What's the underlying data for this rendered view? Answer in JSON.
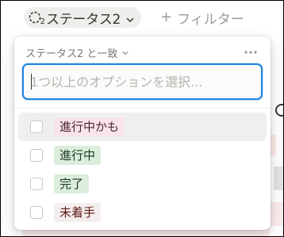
{
  "filter_bar": {
    "status_chip": {
      "label": "ステータス2",
      "badge": "2",
      "icon": "status-icon",
      "chevron_icon": "chevron-down-icon"
    },
    "add_filter": {
      "plus": "+",
      "label": "フィルター"
    }
  },
  "popup": {
    "condition": "ステータス2 と一致",
    "condition_icon": "chevron-down-icon",
    "more_icon": "more-horizontal-icon",
    "search": {
      "value": "",
      "placeholder": "1つ以上のオプションを選択..."
    },
    "options": [
      {
        "label": "進行中かも",
        "checked": false,
        "bg": "#f9e4ec",
        "fg": "#4c2337"
      },
      {
        "label": "進行中",
        "checked": false,
        "bg": "#dbeddb",
        "fg": "#1c3829"
      },
      {
        "label": "完了",
        "checked": false,
        "bg": "#dbeddb",
        "fg": "#1c3829"
      },
      {
        "label": "未着手",
        "checked": false,
        "bg": "#f4eeee",
        "fg": "#5d1715"
      }
    ]
  },
  "colors": {
    "accent": "#2383e2",
    "chip_bg": "#eeeeec",
    "hover_bg": "#efefee"
  }
}
